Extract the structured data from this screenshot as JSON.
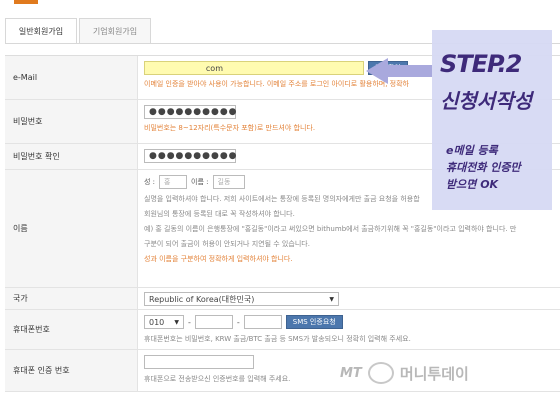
{
  "tabs": [
    {
      "label": "일반회원가입"
    },
    {
      "label": "기업회원가입"
    }
  ],
  "email": {
    "label": "e-Mail",
    "value": "com",
    "button": "중복확인",
    "hint": "이메일 인증을 받아야 사용이 가능합니다. 이메일 주소를 로그인 아이디로 활용하며, 정확하"
  },
  "password": {
    "label": "비밀번호",
    "value": "●●●●●●●●●●",
    "hint": "비밀번호는 8~12자리(특수문자 포함)로 만드셔야 합니다."
  },
  "password_confirm": {
    "label": "비밀번호 확인",
    "value": "●●●●●●●●●●"
  },
  "name": {
    "label": "이름",
    "surname_label": "성 :",
    "surname_placeholder": "홍",
    "given_label": "이름 :",
    "given_placeholder": "길동",
    "notes": [
      "실명을 입력하셔야 합니다. 저희 사이트에서는 통장에 등록된 명의자에게만 출금 요청을 허용합",
      "회원님의 통장에 등록된 대로 꼭 작성하셔야 합니다.",
      "예) 홍 길동의 이름이 은행통장에 \"홍길동\"이라고 써있으면 bithumb에서 출금하기위해 꼭 \"홍길동\"이라고 입력하야 합니다. 만",
      "구분이 되어 출금이 허용이 안되거나 지연될 수 있습니다."
    ],
    "warn": "성과 이름을 구분하여 정확하게 입력하셔야 합니다."
  },
  "country": {
    "label": "국가",
    "value": "Republic of Korea(대한민국)"
  },
  "phone": {
    "label": "휴대폰번호",
    "prefix": "010",
    "dash": "-",
    "button": "SMS 인증요청",
    "note": "휴대폰번호는 비밀번호, KRW 출금/BTC 출금 등 SMS가 발송되오니 정확히 입력해 주세요."
  },
  "phone_verify": {
    "label": "휴대폰 인증 번호",
    "note": "휴대폰으로 전송받으신 인증번호를 입력해 주세요."
  },
  "overlay": {
    "step": "STEP.2",
    "title": "신청서작성",
    "desc1": "e메일 등록",
    "desc2": "휴대전화 인증만",
    "desc3": "받으면 OK",
    "color": "#3e2a7a"
  },
  "watermark": {
    "mt": "MT",
    "text": "머니투데이"
  }
}
